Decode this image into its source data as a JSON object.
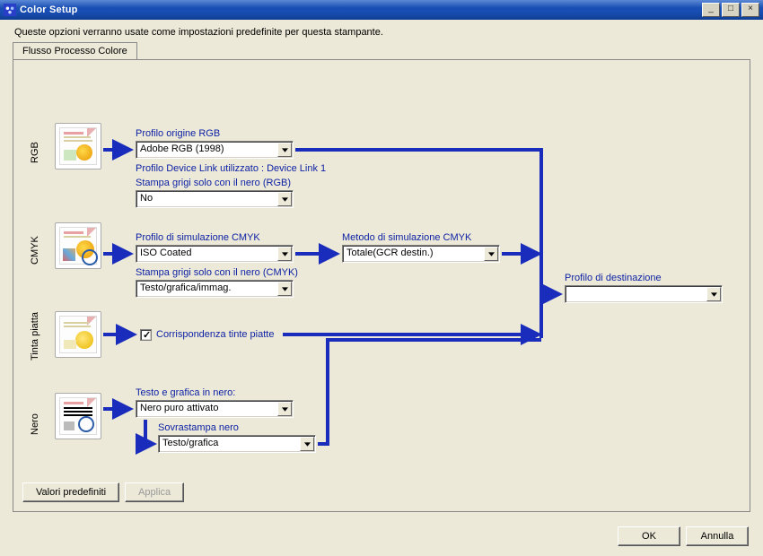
{
  "window": {
    "title": "Color Setup",
    "min": "_",
    "max": "□",
    "close": "×"
  },
  "subheader": "Queste opzioni verranno usate come impostazioni predefinite per questa stampante.",
  "tab_label": "Flusso Processo Colore",
  "sections": {
    "rgb": "RGB",
    "cmyk": "CMYK",
    "spot": "Tinta piatta",
    "black": "Nero"
  },
  "labels": {
    "rgb_source": "Profilo origine RGB",
    "rgb_devicelink": "Profilo Device Link utilizzato : Device Link 1",
    "rgb_gray": "Stampa grigi solo con il nero (RGB)",
    "cmyk_sim": "Profilo di simulazione CMYK",
    "cmyk_method": "Metodo di simulazione CMYK",
    "cmyk_gray": "Stampa grigi solo con il nero (CMYK)",
    "spot_match": "Corrispondenza tinte piatte",
    "black_text": "Testo e grafica in nero:",
    "black_over": "Sovrastampa nero",
    "dest": "Profilo di destinazione"
  },
  "values": {
    "rgb_source": "Adobe RGB (1998)",
    "rgb_gray": "No",
    "cmyk_sim": "ISO Coated",
    "cmyk_method": "Totale(GCR destin.)",
    "cmyk_gray": "Testo/grafica/immag.",
    "black_text": "Nero puro attivato",
    "black_over": "Testo/grafica",
    "dest": ""
  },
  "buttons": {
    "defaults": "Valori predefiniti",
    "apply": "Applica",
    "ok": "OK",
    "cancel": "Annulla"
  }
}
